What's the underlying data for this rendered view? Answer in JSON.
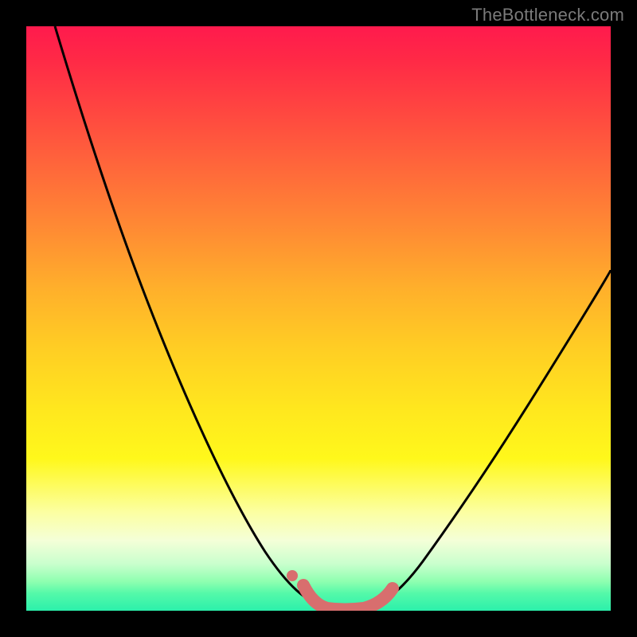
{
  "watermark": {
    "text": "TheBottleneck.com"
  },
  "colors": {
    "page_bg": "#000000",
    "curve": "#000000",
    "marker": "#d86e6e",
    "gradient_stops": [
      "#ff1a4d",
      "#ff2a46",
      "#ff4840",
      "#ff6a3a",
      "#ff8c33",
      "#ffb02b",
      "#ffd023",
      "#ffe81e",
      "#fff81b",
      "#fcffa0",
      "#f4ffd8",
      "#c9ffcd",
      "#8effb0",
      "#55f9a9",
      "#2bf0ab"
    ]
  },
  "chart_data": {
    "type": "line",
    "title": "",
    "xlabel": "",
    "ylabel": "",
    "xlim": [
      0,
      100
    ],
    "ylim": [
      0,
      100
    ],
    "grid": false,
    "legend": false,
    "series": [
      {
        "name": "bottleneck-curve",
        "x": [
          5,
          10,
          15,
          20,
          25,
          30,
          35,
          40,
          45,
          48,
          50,
          52,
          55,
          58,
          60,
          65,
          70,
          75,
          80,
          85,
          90,
          95,
          100
        ],
        "y": [
          100,
          90,
          79,
          68,
          57,
          46,
          35,
          24,
          13,
          6,
          2,
          0,
          0,
          0,
          2,
          7,
          14,
          22,
          30,
          38,
          46,
          53,
          60
        ]
      }
    ],
    "annotations": [
      {
        "name": "optimal-region-marker",
        "style": "thick-rounded",
        "color": "#d86e6e",
        "x": [
          48,
          50,
          52,
          55,
          58,
          60
        ],
        "y": [
          4,
          1,
          0,
          0,
          0,
          1
        ]
      },
      {
        "name": "optimal-dot",
        "style": "dot",
        "color": "#d86e6e",
        "x": 47,
        "y": 5
      }
    ]
  }
}
